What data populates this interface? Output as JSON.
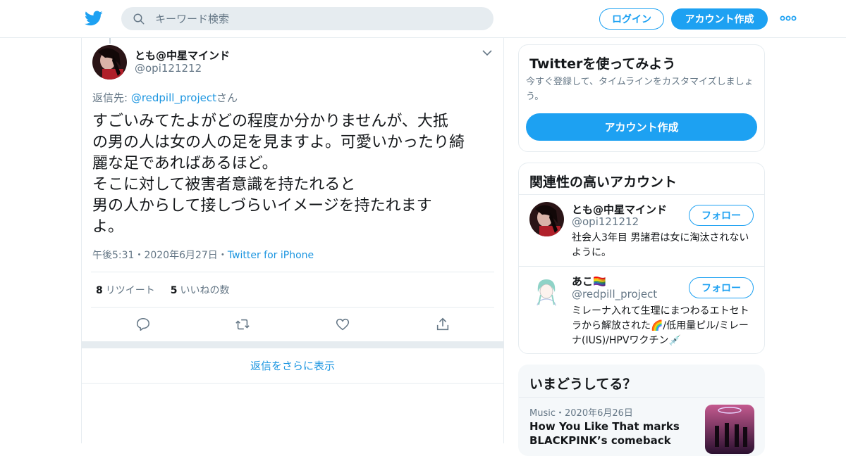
{
  "colors": {
    "accent": "#1da1f2",
    "link": "#1b95e0",
    "muted": "#657786",
    "border": "#e6ecf0"
  },
  "header": {
    "logo_icon": "twitter-bird-icon",
    "search": {
      "placeholder": "キーワード検索",
      "icon": "search-icon"
    },
    "login_label": "ログイン",
    "signup_label": "アカウント作成",
    "more_icon": "more-dots-icon"
  },
  "tweet": {
    "author_name": "とも@中星マインド",
    "author_handle": "@opi121212",
    "reply_prefix": "返信先: ",
    "reply_to": "@redpill_project",
    "reply_suffix": "さん",
    "text": "すごいみてたよがどの程度か分かりませんが、大抵\nの男の人は女の人の足を見ますよ。可愛いかったり綺\n麗な足であればあるほど。\nそこに対して被害者意識を持たれると\n男の人からして接しづらいイメージを持たれます\nよ。",
    "time": "午後5:31",
    "date": "2020年6月27日",
    "separator": "・",
    "source": "Twitter for iPhone",
    "retweet_count": "8",
    "retweet_label": "リツイート",
    "like_count": "5",
    "like_label": "いいねの数",
    "more_replies": "返信をさらに表示"
  },
  "sidebar": {
    "signup_card": {
      "title": "Twitterを使ってみよう",
      "subtitle": "今すぐ登録して、タイムラインをカスタマイズしましょう。",
      "button": "アカウント作成"
    },
    "related": {
      "title": "関連性の高いアカウント",
      "accounts": [
        {
          "name": "とも@中星マインド",
          "handle": "@opi121212",
          "bio": "社会人3年目 男諸君は女に淘汰されないように。",
          "follow": "フォロー"
        },
        {
          "name": "あこ🏳️‍🌈",
          "handle": "@redpill_project",
          "bio": "ミレーナ入れて生理にまつわるエトセトラから解放された🌈/低用量ピル/ミレーナ(IUS)/HPVワクチン💉",
          "follow": "フォロー"
        }
      ]
    },
    "trends": {
      "title": "いまどうしてる？",
      "items": [
        {
          "category": "Music",
          "separator": "・",
          "date": "2020年6月26日",
          "title": "How You Like That marks BLACKPINK’s comeback"
        }
      ]
    }
  }
}
